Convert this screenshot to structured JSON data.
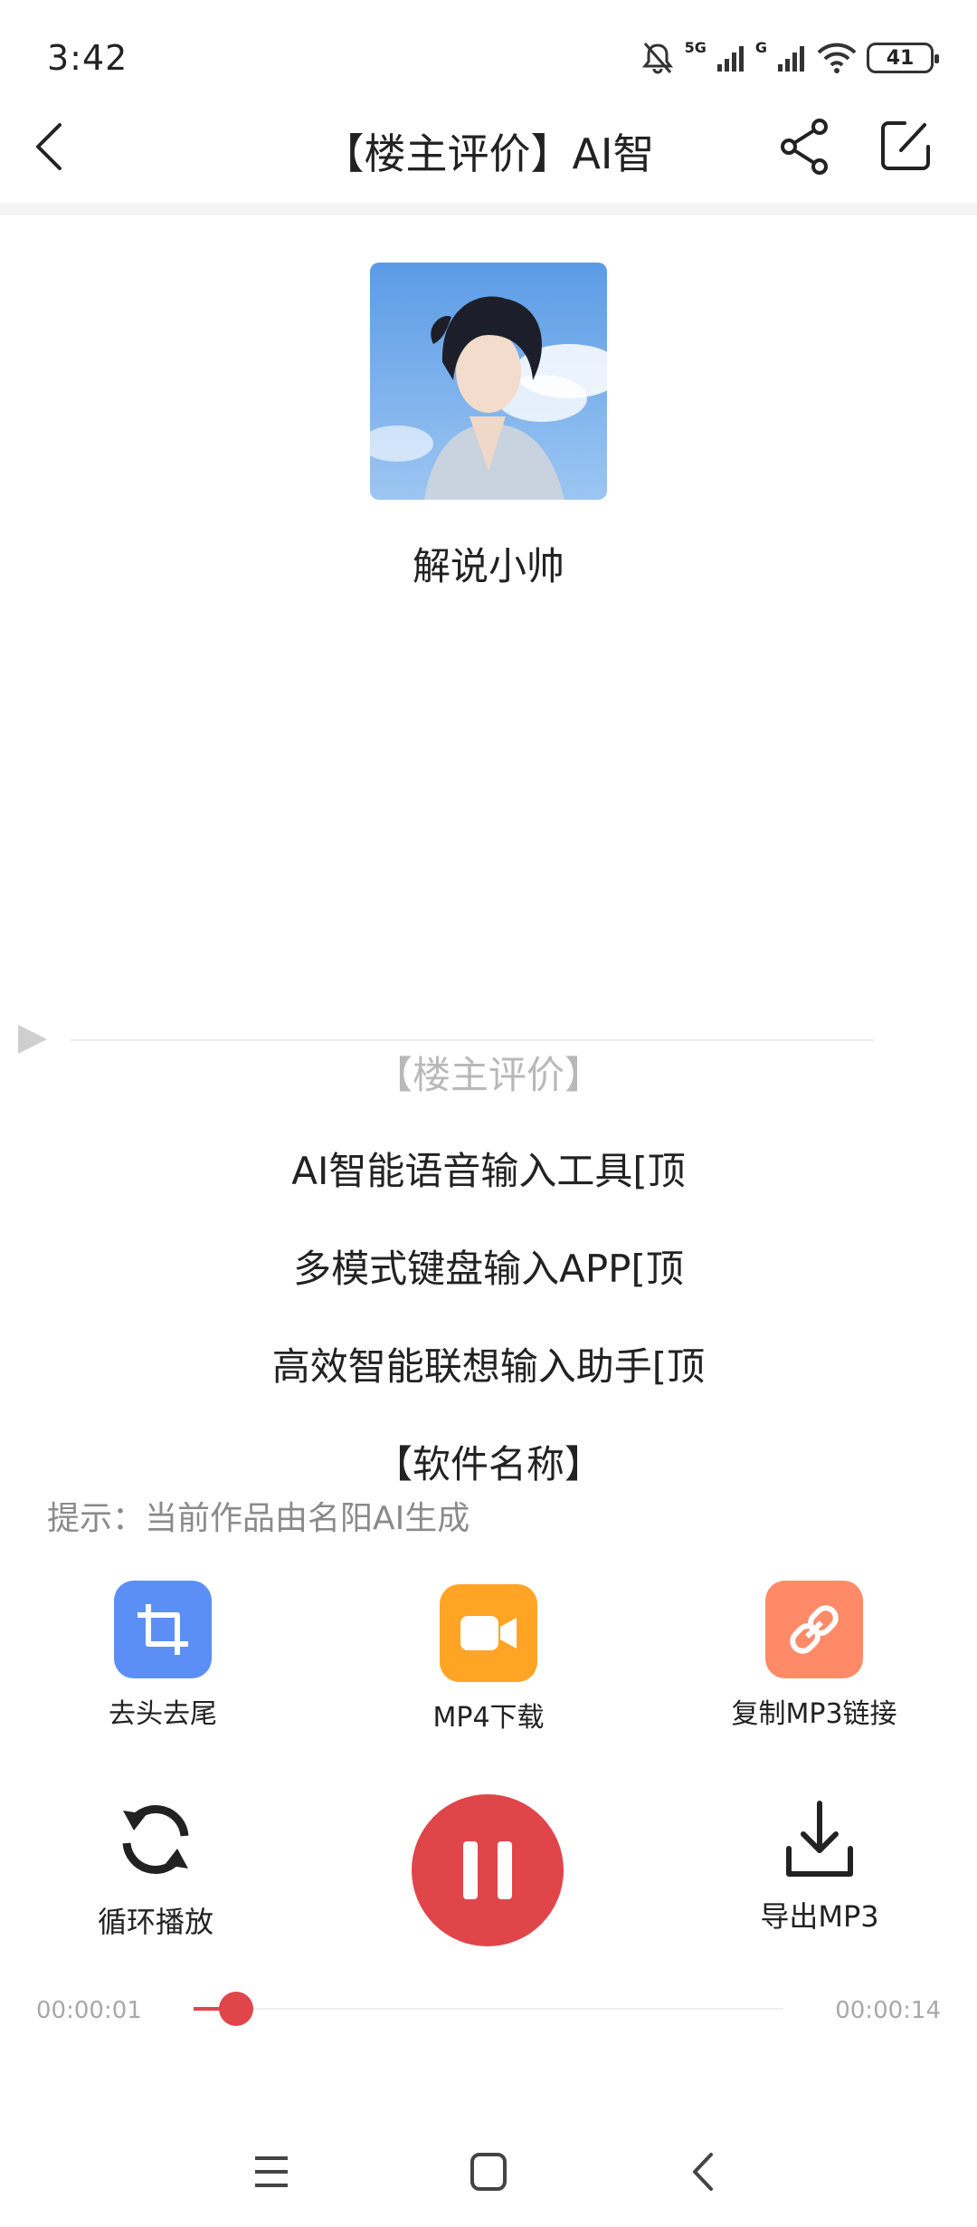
{
  "status_bar": {
    "time": "3:42",
    "network_1": "5G",
    "network_2": "G",
    "battery": "41"
  },
  "header": {
    "title": "【楼主评价】AI智"
  },
  "narrator": {
    "name": "解说小帅"
  },
  "lyrics": [
    "【楼主评价】",
    "AI智能语音输入工具[顶",
    "多模式键盘输入APP[顶",
    "高效智能联想输入助手[顶",
    "【软件名称】"
  ],
  "hint": "提示：当前作品由名阳AI生成",
  "actions": [
    {
      "label": "去头去尾",
      "icon": "crop-icon",
      "color": "#5c8ff5"
    },
    {
      "label": "MP4下载",
      "icon": "video-camera-icon",
      "color": "#ffa425"
    },
    {
      "label": "复制MP3链接",
      "icon": "link-icon",
      "color": "#ff8a68"
    }
  ],
  "controls": {
    "loop_label": "循环播放",
    "export_label": "导出MP3"
  },
  "progress": {
    "current": "00:00:01",
    "total": "00:00:14",
    "fraction": 0.0714
  },
  "colors": {
    "accent": "#e0454a"
  }
}
